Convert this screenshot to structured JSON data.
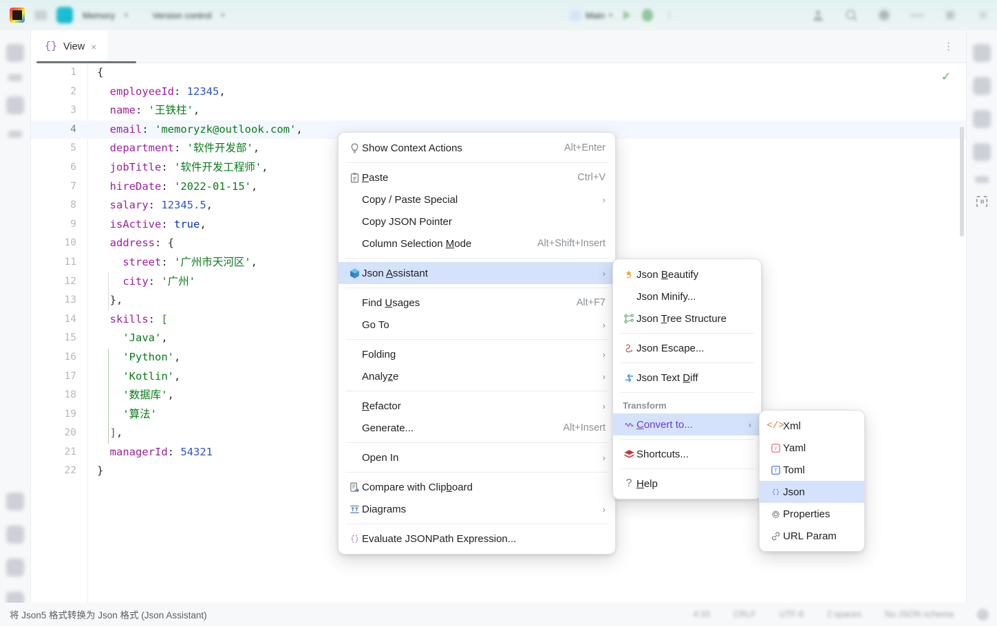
{
  "titlebar": {
    "project_name": "Memory",
    "vcs_label": "Version control",
    "run_config": "Main",
    "icons": [
      "jetbrains-logo-icon",
      "hamburger-menu-icon",
      "project-icon",
      "chevron-down-icon",
      "run-icon",
      "coverage-icon",
      "more-vertical-icon",
      "account-icon",
      "search-icon",
      "settings-icon",
      "minimize-icon",
      "maximize-icon",
      "close-icon"
    ]
  },
  "editor": {
    "tab": {
      "label": "View",
      "icon": "json-braces-icon",
      "close": "×"
    },
    "kebab": "⋮",
    "inspection_status": "✓",
    "lines": [
      {
        "num": "1",
        "tokens": [
          {
            "t": "{",
            "c": "p"
          }
        ]
      },
      {
        "num": "2",
        "tokens": [
          {
            "t": "  ",
            "c": "p"
          },
          {
            "t": "employeeId",
            "c": "k"
          },
          {
            "t": ": ",
            "c": "p"
          },
          {
            "t": "12345",
            "c": "n"
          },
          {
            "t": ",",
            "c": "p"
          }
        ]
      },
      {
        "num": "3",
        "tokens": [
          {
            "t": "  ",
            "c": "p"
          },
          {
            "t": "name",
            "c": "k"
          },
          {
            "t": ": ",
            "c": "p"
          },
          {
            "t": "'王铁柱'",
            "c": "s"
          },
          {
            "t": ",",
            "c": "p"
          }
        ]
      },
      {
        "num": "4",
        "tokens": [
          {
            "t": "  ",
            "c": "p"
          },
          {
            "t": "email",
            "c": "k"
          },
          {
            "t": ": ",
            "c": "p"
          },
          {
            "t": "'memoryzk@outlook.com'",
            "c": "s"
          },
          {
            "t": ",",
            "c": "p"
          }
        ],
        "current": true
      },
      {
        "num": "5",
        "tokens": [
          {
            "t": "  ",
            "c": "p"
          },
          {
            "t": "department",
            "c": "k"
          },
          {
            "t": ": ",
            "c": "p"
          },
          {
            "t": "'软件开发部'",
            "c": "s"
          },
          {
            "t": ",",
            "c": "p"
          }
        ]
      },
      {
        "num": "6",
        "tokens": [
          {
            "t": "  ",
            "c": "p"
          },
          {
            "t": "jobTitle",
            "c": "k"
          },
          {
            "t": ": ",
            "c": "p"
          },
          {
            "t": "'软件开发工程师'",
            "c": "s"
          },
          {
            "t": ",",
            "c": "p"
          }
        ]
      },
      {
        "num": "7",
        "tokens": [
          {
            "t": "  ",
            "c": "p"
          },
          {
            "t": "hireDate",
            "c": "k"
          },
          {
            "t": ": ",
            "c": "p"
          },
          {
            "t": "'2022-01-15'",
            "c": "s"
          },
          {
            "t": ",",
            "c": "p"
          }
        ]
      },
      {
        "num": "8",
        "tokens": [
          {
            "t": "  ",
            "c": "p"
          },
          {
            "t": "salary",
            "c": "k"
          },
          {
            "t": ": ",
            "c": "p"
          },
          {
            "t": "12345.5",
            "c": "n"
          },
          {
            "t": ",",
            "c": "p"
          }
        ]
      },
      {
        "num": "9",
        "tokens": [
          {
            "t": "  ",
            "c": "p"
          },
          {
            "t": "isActive",
            "c": "k"
          },
          {
            "t": ": ",
            "c": "p"
          },
          {
            "t": "true",
            "c": "b"
          },
          {
            "t": ",",
            "c": "p"
          }
        ]
      },
      {
        "num": "10",
        "tokens": [
          {
            "t": "  ",
            "c": "p"
          },
          {
            "t": "address",
            "c": "k"
          },
          {
            "t": ": ",
            "c": "p"
          },
          {
            "t": "{",
            "c": "p"
          }
        ]
      },
      {
        "num": "11",
        "tokens": [
          {
            "t": "    ",
            "c": "p"
          },
          {
            "t": "street",
            "c": "k"
          },
          {
            "t": ": ",
            "c": "p"
          },
          {
            "t": "'广州市天河区'",
            "c": "s"
          },
          {
            "t": ",",
            "c": "p"
          }
        ]
      },
      {
        "num": "12",
        "tokens": [
          {
            "t": "    ",
            "c": "p"
          },
          {
            "t": "city",
            "c": "k"
          },
          {
            "t": ": ",
            "c": "p"
          },
          {
            "t": "'广州'",
            "c": "s"
          }
        ]
      },
      {
        "num": "13",
        "tokens": [
          {
            "t": "  ",
            "c": "p"
          },
          {
            "t": "}",
            "c": "p"
          },
          {
            "t": ",",
            "c": "p"
          }
        ]
      },
      {
        "num": "14",
        "tokens": [
          {
            "t": "  ",
            "c": "p"
          },
          {
            "t": "skills",
            "c": "k"
          },
          {
            "t": ": ",
            "c": "p"
          },
          {
            "t": "[",
            "c": "br"
          }
        ]
      },
      {
        "num": "15",
        "tokens": [
          {
            "t": "    ",
            "c": "p"
          },
          {
            "t": "'Java'",
            "c": "s"
          },
          {
            "t": ",",
            "c": "p"
          }
        ]
      },
      {
        "num": "16",
        "tokens": [
          {
            "t": "    ",
            "c": "p"
          },
          {
            "t": "'Python'",
            "c": "s"
          },
          {
            "t": ",",
            "c": "p"
          }
        ]
      },
      {
        "num": "17",
        "tokens": [
          {
            "t": "    ",
            "c": "p"
          },
          {
            "t": "'Kotlin'",
            "c": "s"
          },
          {
            "t": ",",
            "c": "p"
          }
        ]
      },
      {
        "num": "18",
        "tokens": [
          {
            "t": "    ",
            "c": "p"
          },
          {
            "t": "'数据库'",
            "c": "s"
          },
          {
            "t": ",",
            "c": "p"
          }
        ]
      },
      {
        "num": "19",
        "tokens": [
          {
            "t": "    ",
            "c": "p"
          },
          {
            "t": "'算法'",
            "c": "s"
          }
        ]
      },
      {
        "num": "20",
        "tokens": [
          {
            "t": "  ",
            "c": "p"
          },
          {
            "t": "]",
            "c": "br"
          },
          {
            "t": ",",
            "c": "p"
          }
        ]
      },
      {
        "num": "21",
        "tokens": [
          {
            "t": "  ",
            "c": "p"
          },
          {
            "t": "managerId",
            "c": "k"
          },
          {
            "t": ": ",
            "c": "p"
          },
          {
            "t": "54321",
            "c": "n"
          }
        ]
      },
      {
        "num": "22",
        "tokens": [
          {
            "t": "}",
            "c": "p"
          }
        ]
      }
    ]
  },
  "context_menu": {
    "items": [
      {
        "icon": "lightbulb-icon",
        "label": "Show Context Actions",
        "shortcut": "Alt+Enter",
        "mnemonic": ""
      },
      {
        "sep": true
      },
      {
        "icon": "clipboard-paste-icon",
        "label": "Paste",
        "shortcut": "Ctrl+V",
        "mnemonic": "P"
      },
      {
        "icon": "",
        "label": "Copy / Paste Special",
        "shortcut": "",
        "arrow": true
      },
      {
        "icon": "",
        "label": "Copy JSON Pointer",
        "shortcut": ""
      },
      {
        "icon": "",
        "label": "Column Selection Mode",
        "shortcut": "Alt+Shift+Insert",
        "mnemonic": "M"
      },
      {
        "sep": true
      },
      {
        "icon": "json-assistant-box-icon",
        "label": "Json Assistant",
        "shortcut": "",
        "arrow": true,
        "selected": true,
        "mnemonic": "A"
      },
      {
        "sep": true
      },
      {
        "icon": "",
        "label": "Find Usages",
        "shortcut": "Alt+F7",
        "mnemonic": "U"
      },
      {
        "icon": "",
        "label": "Go To",
        "shortcut": "",
        "arrow": true
      },
      {
        "sep": true
      },
      {
        "icon": "",
        "label": "Folding",
        "shortcut": "",
        "arrow": true
      },
      {
        "icon": "",
        "label": "Analyze",
        "shortcut": "",
        "arrow": true,
        "mnemonic": "z"
      },
      {
        "sep": true
      },
      {
        "icon": "",
        "label": "Refactor",
        "shortcut": "",
        "arrow": true,
        "mnemonic": "R"
      },
      {
        "icon": "",
        "label": "Generate...",
        "shortcut": "Alt+Insert"
      },
      {
        "sep": true
      },
      {
        "icon": "",
        "label": "Open In",
        "shortcut": "",
        "arrow": true
      },
      {
        "sep": true
      },
      {
        "icon": "compare-clipboard-icon",
        "label": "Compare with Clipboard",
        "shortcut": "",
        "mnemonic": "b"
      },
      {
        "icon": "diagrams-icon",
        "label": "Diagrams",
        "shortcut": "",
        "arrow": true
      },
      {
        "sep": true
      },
      {
        "icon": "json-braces-icon",
        "label": "Evaluate JSONPath Expression...",
        "shortcut": ""
      }
    ]
  },
  "json_assistant_menu": {
    "items": [
      {
        "icon": "beautify-star-icon",
        "label": "Json Beautify",
        "mnemonic": "B"
      },
      {
        "icon": "",
        "label": "Json Minify..."
      },
      {
        "icon": "tree-structure-icon",
        "label": "Json Tree Structure",
        "mnemonic": "T"
      },
      {
        "sep": true
      },
      {
        "icon": "escape-icon",
        "label": "Json Escape..."
      },
      {
        "sep": true
      },
      {
        "icon": "text-diff-icon",
        "label": "Json Text Diff",
        "mnemonic": "D"
      },
      {
        "sep": true
      },
      {
        "caption": "Transform"
      },
      {
        "icon": "convert-icon",
        "label": "Convert to...",
        "arrow": true,
        "selected": true,
        "mnemonic": "C"
      },
      {
        "sep": true
      },
      {
        "icon": "shortcuts-layers-icon",
        "label": "Shortcuts..."
      },
      {
        "sep": true
      },
      {
        "icon": "help-icon",
        "label": "Help",
        "mnemonic": "H"
      }
    ]
  },
  "convert_menu": {
    "items": [
      {
        "icon": "xml-icon",
        "label": "Xml"
      },
      {
        "icon": "yaml-icon",
        "label": "Yaml"
      },
      {
        "icon": "toml-icon",
        "label": "Toml"
      },
      {
        "icon": "json-icon",
        "label": "Json",
        "selected": true
      },
      {
        "icon": "properties-icon",
        "label": "Properties"
      },
      {
        "icon": "url-param-icon",
        "label": "URL Param"
      }
    ]
  },
  "statusbar": {
    "message": "将 Json5 格式转换为 Json 格式 (Json Assistant)",
    "caret": "4:33",
    "line_separator": "CRLF",
    "encoding": "UTF-8",
    "indent": "2 spaces",
    "schema": "No JSON schema",
    "notification_icon": "bell-icon"
  },
  "colors": {
    "selection": "#D4E2FC",
    "accent_green": "#59A869",
    "key": "#9B1FA0",
    "string": "#067D17",
    "number": "#2B54C8"
  }
}
